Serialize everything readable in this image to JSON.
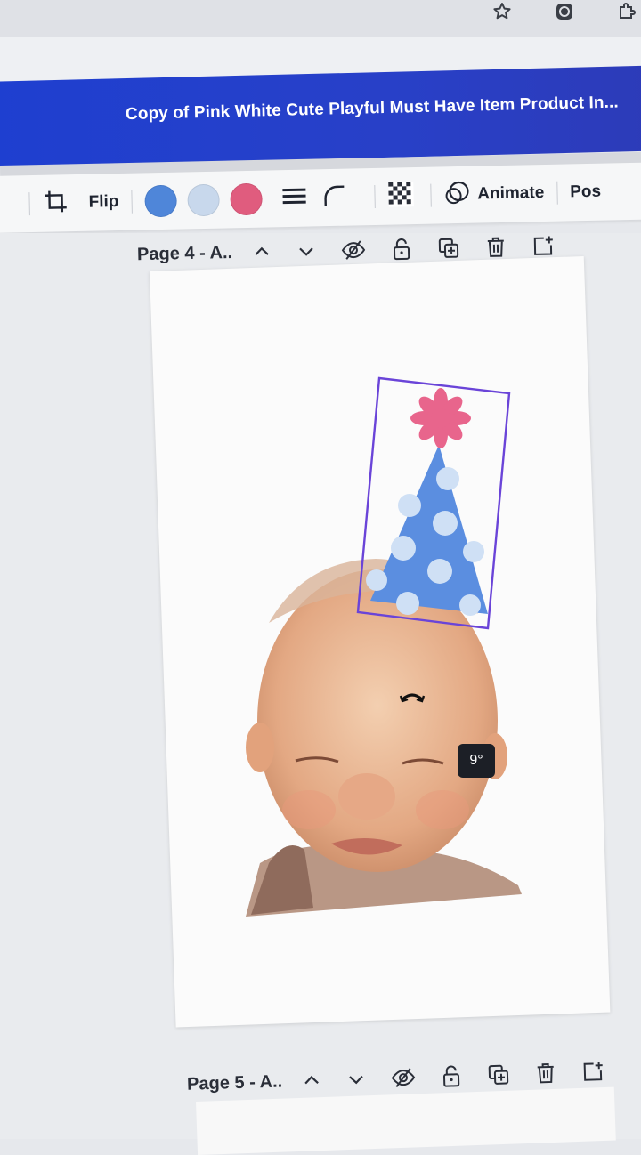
{
  "document": {
    "title": "Copy of Pink White Cute Playful Must Have Item Product In..."
  },
  "toolbar": {
    "flip_label": "Flip",
    "animate_label": "Animate",
    "position_label": "Pos",
    "colors": [
      "#4f86d9",
      "#c8d8ec",
      "#e05c7e"
    ]
  },
  "pages": [
    {
      "label": "Page 4 - A.."
    },
    {
      "label": "Page 5 - A.."
    }
  ],
  "selection": {
    "rotation_label": "9°"
  }
}
